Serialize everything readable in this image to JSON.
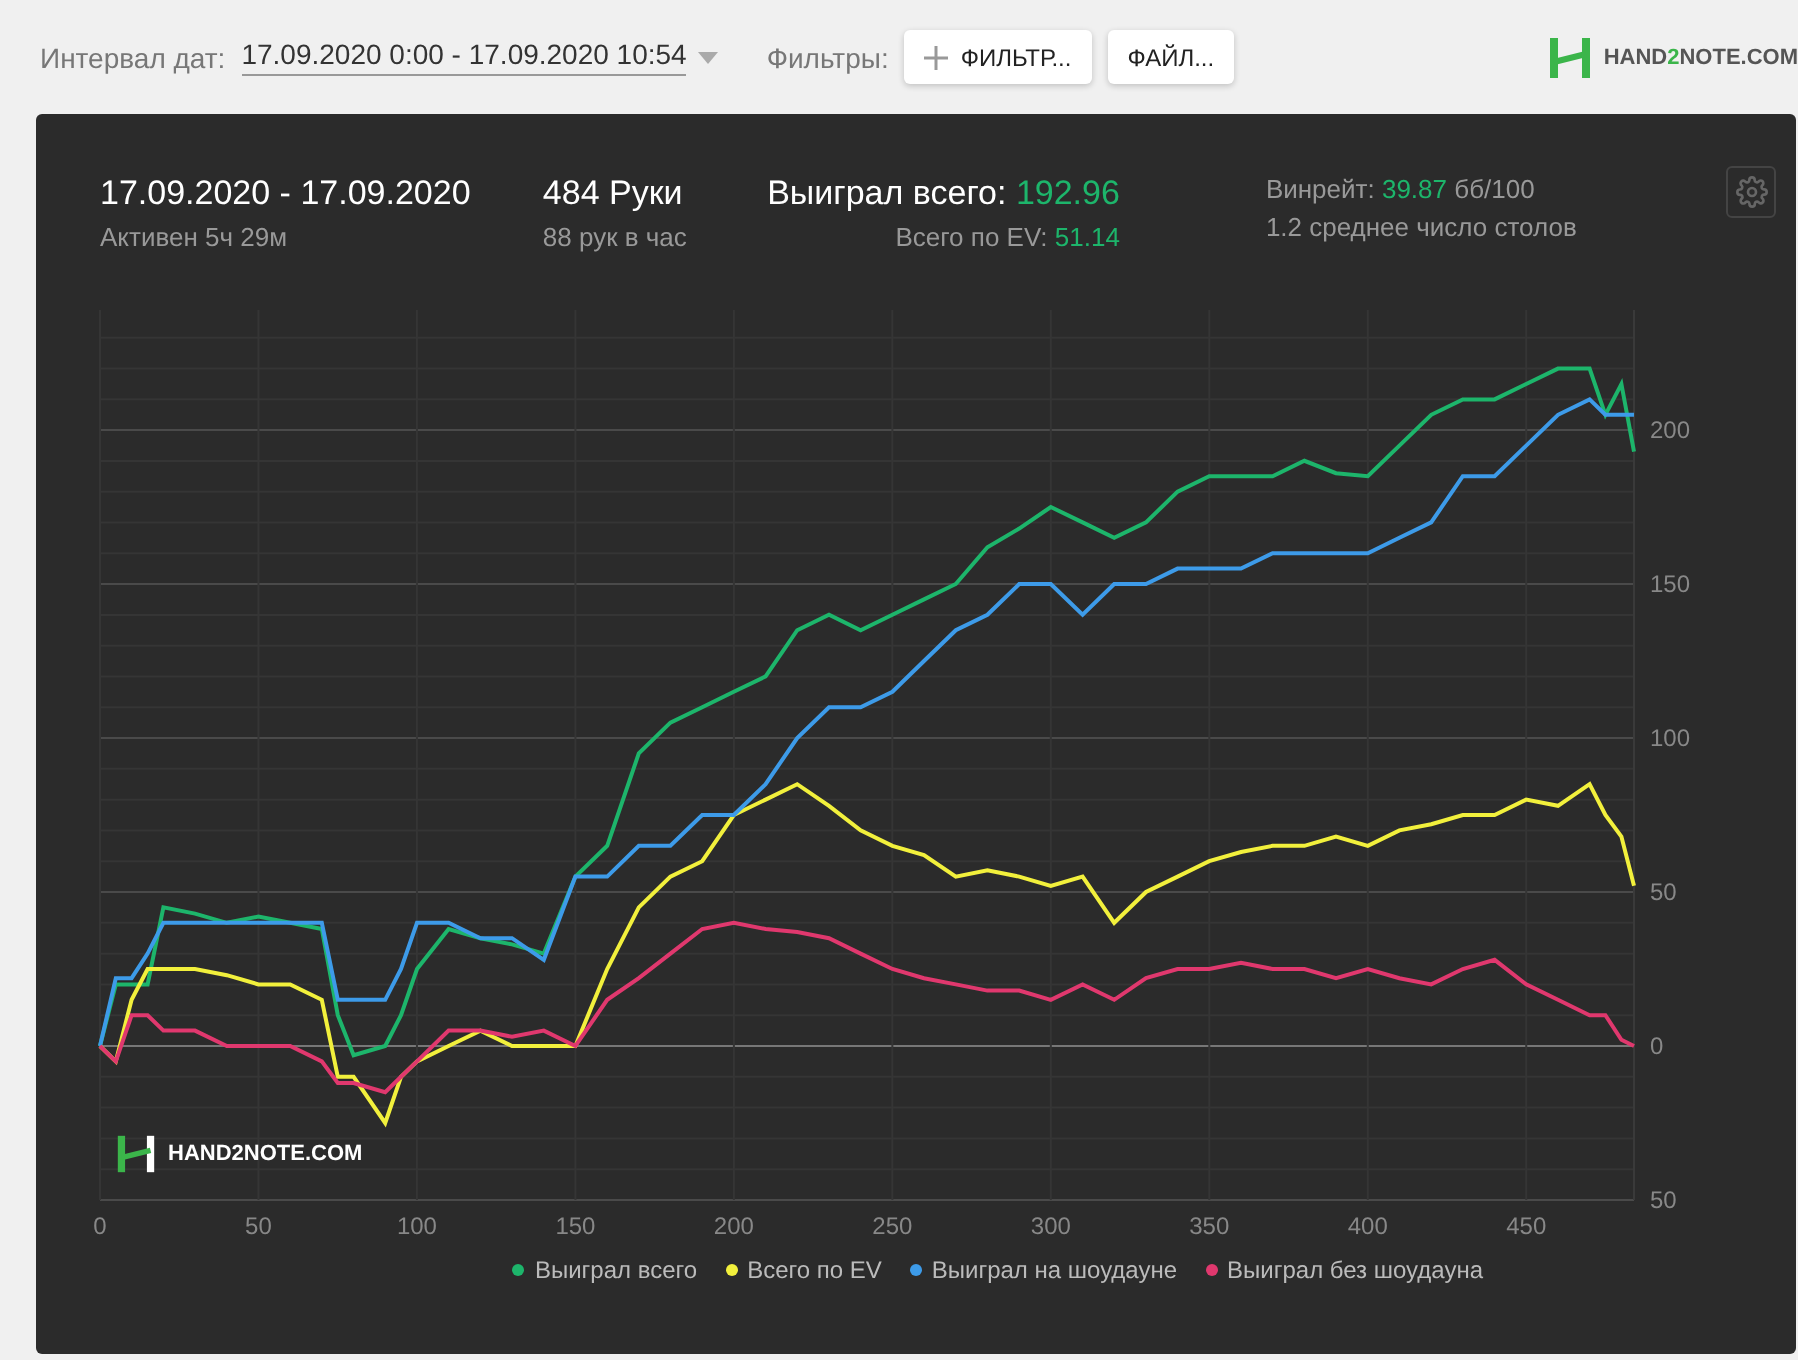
{
  "toolbar": {
    "date_label": "Интервал дат:",
    "date_range": "17.09.2020 0:00 - 17.09.2020 10:54",
    "filters_label": "Фильтры:",
    "filter_button": "ФИЛЬТР...",
    "file_button": "ФАЙЛ...",
    "logo": [
      {
        "text": "HAND",
        "accent": false
      },
      {
        "text": "2",
        "accent": true
      },
      {
        "text": "NOTE.COM",
        "accent": false
      }
    ]
  },
  "summary": {
    "period": "17.09.2020 - 17.09.2020",
    "active": "Активен 5ч 29м",
    "hands": "484 Руки",
    "hands_per_hour": "88 рук в час",
    "won_label": "Выиграл всего:",
    "won_value": "192.96",
    "ev_label": "Всего по EV:",
    "ev_value": "51.14",
    "winrate_label": "Винрейт:",
    "winrate_value": "39.87",
    "winrate_unit": "бб/100",
    "tables": "1.2 среднее число столов"
  },
  "chart": {
    "watermark": "HAND2NOTE.COM",
    "chart_data": {
      "type": "line",
      "grid": true,
      "x": [
        0,
        5,
        10,
        15,
        20,
        30,
        40,
        50,
        60,
        70,
        75,
        80,
        90,
        95,
        100,
        110,
        120,
        130,
        140,
        150,
        160,
        170,
        180,
        190,
        200,
        210,
        220,
        230,
        240,
        250,
        260,
        270,
        280,
        290,
        300,
        310,
        320,
        330,
        340,
        350,
        360,
        370,
        380,
        390,
        400,
        410,
        420,
        430,
        440,
        450,
        460,
        470,
        475,
        480,
        484
      ],
      "xlim": [
        0,
        484
      ],
      "ylim": [
        -50,
        239
      ],
      "xticks": [
        0,
        50,
        100,
        150,
        200,
        250,
        300,
        350,
        400,
        450
      ],
      "yticks": [
        {
          "value": -50,
          "label": "50"
        },
        0,
        50,
        100,
        150,
        200
      ],
      "series": [
        {
          "name": "Выиграл всего",
          "color": "#1db56b",
          "values": [
            0,
            20,
            20,
            20,
            45,
            43,
            40,
            42,
            40,
            38,
            10,
            -3,
            0,
            10,
            25,
            38,
            35,
            33,
            30,
            55,
            65,
            95,
            105,
            110,
            115,
            120,
            135,
            140,
            135,
            140,
            145,
            150,
            162,
            168,
            175,
            170,
            165,
            170,
            180,
            185,
            185,
            185,
            190,
            186,
            185,
            195,
            205,
            210,
            210,
            215,
            220,
            220,
            205,
            215,
            193
          ]
        },
        {
          "name": "Всего по EV",
          "color": "#f2f03c",
          "values": [
            0,
            -5,
            15,
            25,
            25,
            25,
            23,
            20,
            20,
            15,
            -10,
            -10,
            -25,
            -10,
            -5,
            0,
            5,
            0,
            0,
            0,
            25,
            45,
            55,
            60,
            75,
            80,
            85,
            78,
            70,
            65,
            62,
            55,
            57,
            55,
            52,
            55,
            40,
            50,
            55,
            60,
            63,
            65,
            65,
            68,
            65,
            70,
            72,
            75,
            75,
            80,
            78,
            85,
            75,
            68,
            52
          ]
        },
        {
          "name": "Выиграл на шоудауне",
          "color": "#3d9be9",
          "values": [
            0,
            22,
            22,
            30,
            40,
            40,
            40,
            40,
            40,
            40,
            15,
            15,
            15,
            25,
            40,
            40,
            35,
            35,
            28,
            55,
            55,
            65,
            65,
            75,
            75,
            85,
            100,
            110,
            110,
            115,
            125,
            135,
            140,
            150,
            150,
            140,
            150,
            150,
            155,
            155,
            155,
            160,
            160,
            160,
            160,
            165,
            170,
            185,
            185,
            195,
            205,
            210,
            205,
            205,
            205
          ]
        },
        {
          "name": "Выиграл без шоудауна",
          "color": "#e0386e",
          "values": [
            0,
            -5,
            10,
            10,
            5,
            5,
            0,
            0,
            0,
            -5,
            -12,
            -12,
            -15,
            -10,
            -5,
            5,
            5,
            3,
            5,
            0,
            15,
            22,
            30,
            38,
            40,
            38,
            37,
            35,
            30,
            25,
            22,
            20,
            18,
            18,
            15,
            20,
            15,
            22,
            25,
            25,
            27,
            25,
            25,
            22,
            25,
            22,
            20,
            25,
            28,
            20,
            15,
            10,
            10,
            2,
            0
          ]
        }
      ]
    }
  }
}
